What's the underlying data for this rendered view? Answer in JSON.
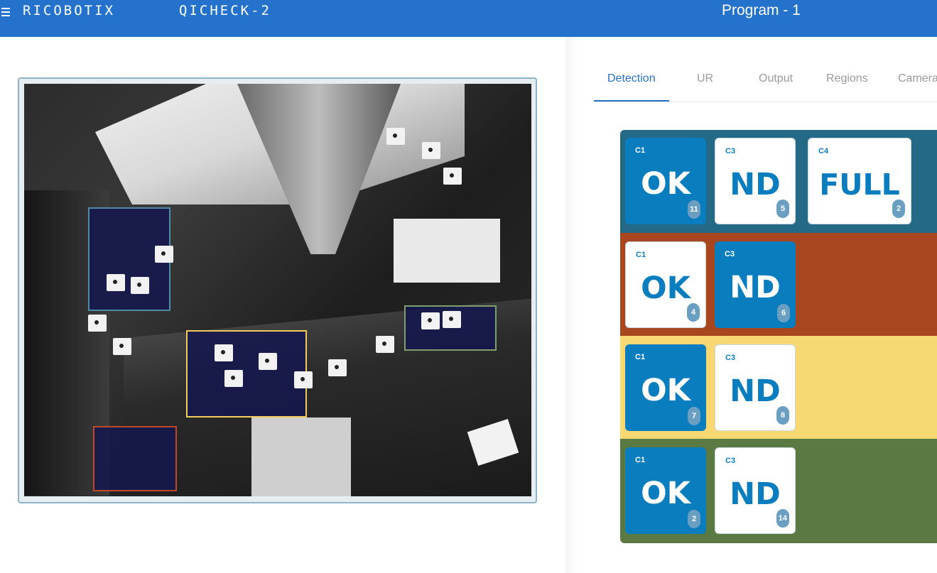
{
  "header": {
    "brand": "RICOBOTIX",
    "product": "QICHECK-2",
    "program_title": "Program - 1"
  },
  "tabs": [
    {
      "label": "Detection",
      "active": true
    },
    {
      "label": "UR",
      "active": false
    },
    {
      "label": "Output",
      "active": false
    },
    {
      "label": "Regions",
      "active": false
    },
    {
      "label": "Camera",
      "active": false
    }
  ],
  "colors": {
    "accent": "#2472cc",
    "tile_blue": "#0a7dbf",
    "row_1": "#246a86",
    "row_2": "#a84620",
    "row_3": "#f7d872",
    "row_4": "#5b7a43",
    "region_blue": "#4f8aa8",
    "region_yellow": "#f2cc5a",
    "region_green": "#7fa06a",
    "region_red": "#c0492a"
  },
  "regions": [
    {
      "id": "region-blue",
      "color": "#4f8aa8"
    },
    {
      "id": "region-yellow",
      "color": "#f2cc5a"
    },
    {
      "id": "region-green",
      "color": "#7fa06a"
    },
    {
      "id": "region-red",
      "color": "#c0492a"
    }
  ],
  "rows": [
    {
      "tiles": [
        {
          "label": "C1",
          "status": "OK",
          "count": "11",
          "style": "blue"
        },
        {
          "label": "C3",
          "status": "ND",
          "count": "5",
          "style": "white"
        },
        {
          "label": "C4",
          "status": "FULL",
          "count": "2",
          "style": "white"
        }
      ]
    },
    {
      "tiles": [
        {
          "label": "C1",
          "status": "OK",
          "count": "4",
          "style": "white"
        },
        {
          "label": "C3",
          "status": "ND",
          "count": "6",
          "style": "blue"
        }
      ]
    },
    {
      "tiles": [
        {
          "label": "C1",
          "status": "OK",
          "count": "7",
          "style": "blue"
        },
        {
          "label": "C3",
          "status": "ND",
          "count": "8",
          "style": "white"
        }
      ]
    },
    {
      "tiles": [
        {
          "label": "C1",
          "status": "OK",
          "count": "2",
          "style": "blue"
        },
        {
          "label": "C3",
          "status": "ND",
          "count": "14",
          "style": "white"
        }
      ]
    }
  ]
}
